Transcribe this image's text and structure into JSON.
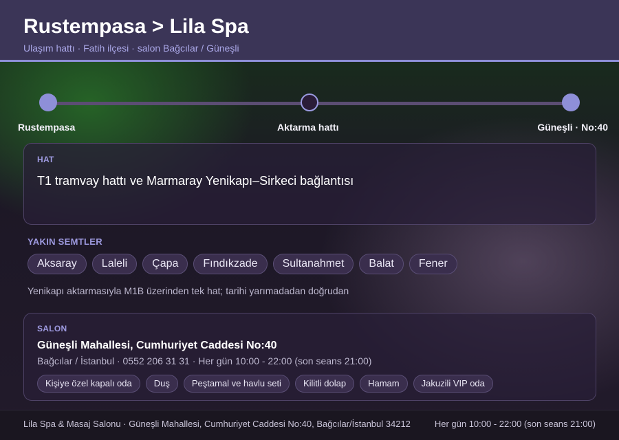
{
  "header": {
    "title": "Rustempasa > Lila Spa",
    "subtitle": "Ulaşım hattı · Fatih ilçesi · salon Bağcılar / Güneşli"
  },
  "route": {
    "stops": [
      {
        "label": "Rustempasa",
        "style": "filled"
      },
      {
        "label": "Aktarma hattı",
        "style": "hollow"
      },
      {
        "label": "Güneşli · No:40",
        "style": "filled"
      }
    ]
  },
  "line_card": {
    "label": "HAT",
    "text": "T1 tramvay hattı ve Marmaray Yenikapı–Sirkeci bağlantısı"
  },
  "nearby": {
    "label": "YAKIN SEMTLER",
    "items": [
      "Aksaray",
      "Laleli",
      "Çapa",
      "Fındıkzade",
      "Sultanahmet",
      "Balat",
      "Fener"
    ],
    "note": "Yenikapı aktarmasıyla M1B üzerinden tek hat; tarihi yarımadadan doğrudan"
  },
  "salon": {
    "label": "SALON",
    "address": "Güneşli Mahallesi, Cumhuriyet Caddesi No:40",
    "meta": "Bağcılar / İstanbul · 0552 206 31 31 · Her gün 10:00 - 22:00 (son seans 21:00)",
    "amenities": [
      "Kişiye özel kapalı oda",
      "Duş",
      "Peştamal ve havlu seti",
      "Kilitli dolap",
      "Hamam",
      "Jakuzili VIP oda"
    ]
  },
  "footer": {
    "left": "Lila Spa & Masaj Salonu · Güneşli Mahallesi, Cumhuriyet Caddesi No:40, Bağcılar/İstanbul 34212",
    "right": "Her gün 10:00 - 22:00 (son seans 21:00)"
  },
  "colors": {
    "accent": "#8e8fd8",
    "header_bg": "#3b3557",
    "label": "#9e9ae0"
  }
}
